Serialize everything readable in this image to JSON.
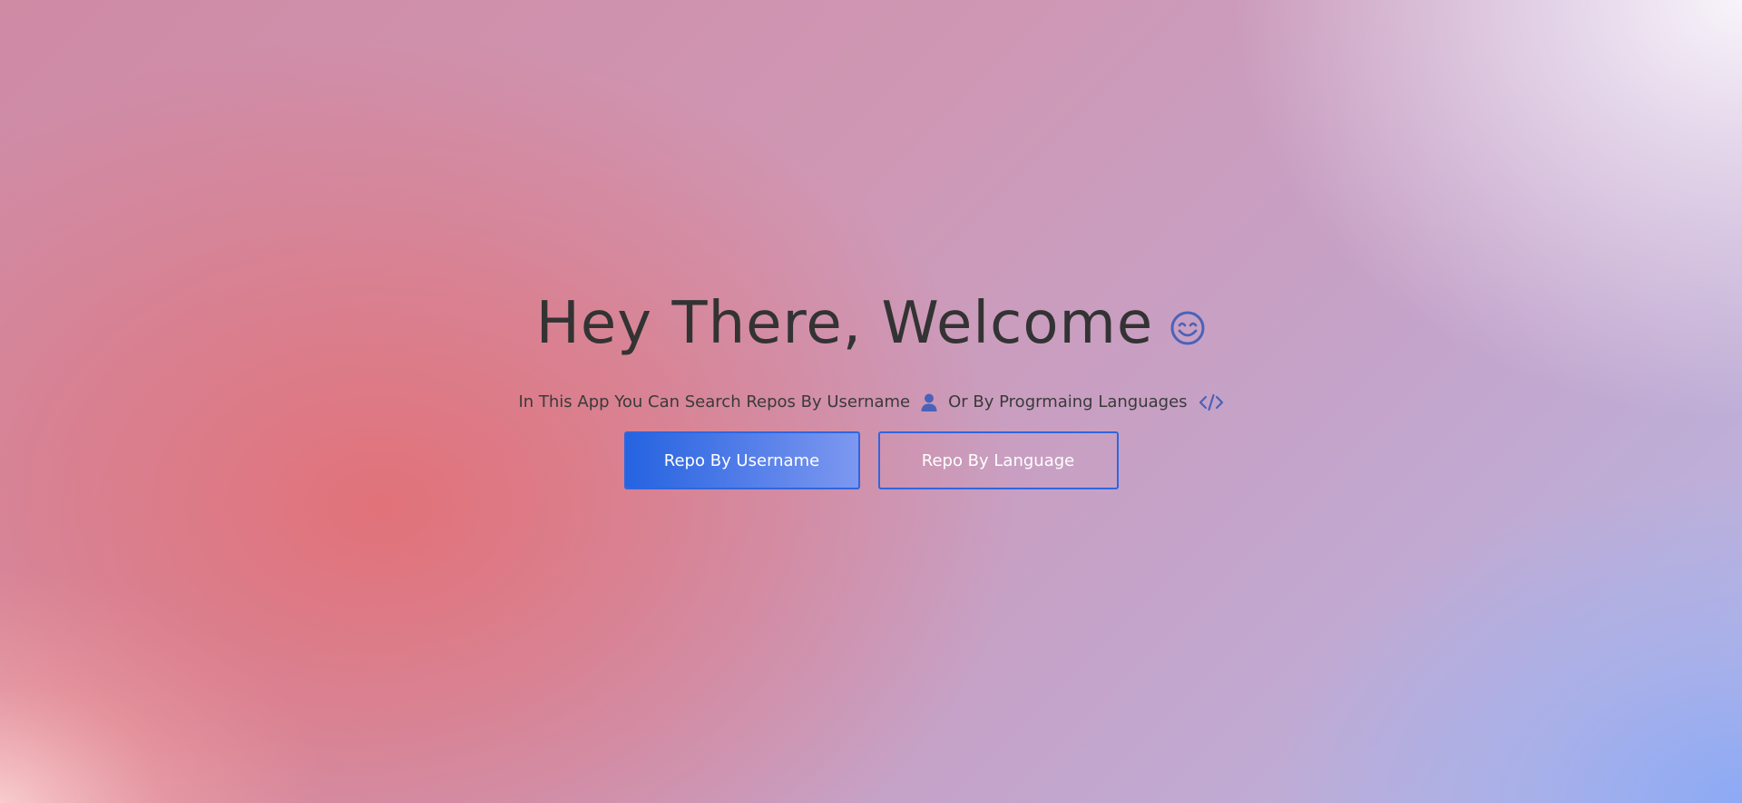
{
  "hero": {
    "title": "Hey There, Welcome",
    "title_icon": "smile-icon",
    "subtitle_part1": "In This App You Can Search Repos By Username",
    "subtitle_icon1": "user-icon",
    "subtitle_part2": "Or By Progrmaing Languages",
    "subtitle_icon2": "code-icon"
  },
  "buttons": {
    "username_label": "Repo By Username",
    "language_label": "Repo By Language"
  },
  "colors": {
    "accent": "#2f66df",
    "icon": "#4a62b8",
    "text": "#333333"
  }
}
